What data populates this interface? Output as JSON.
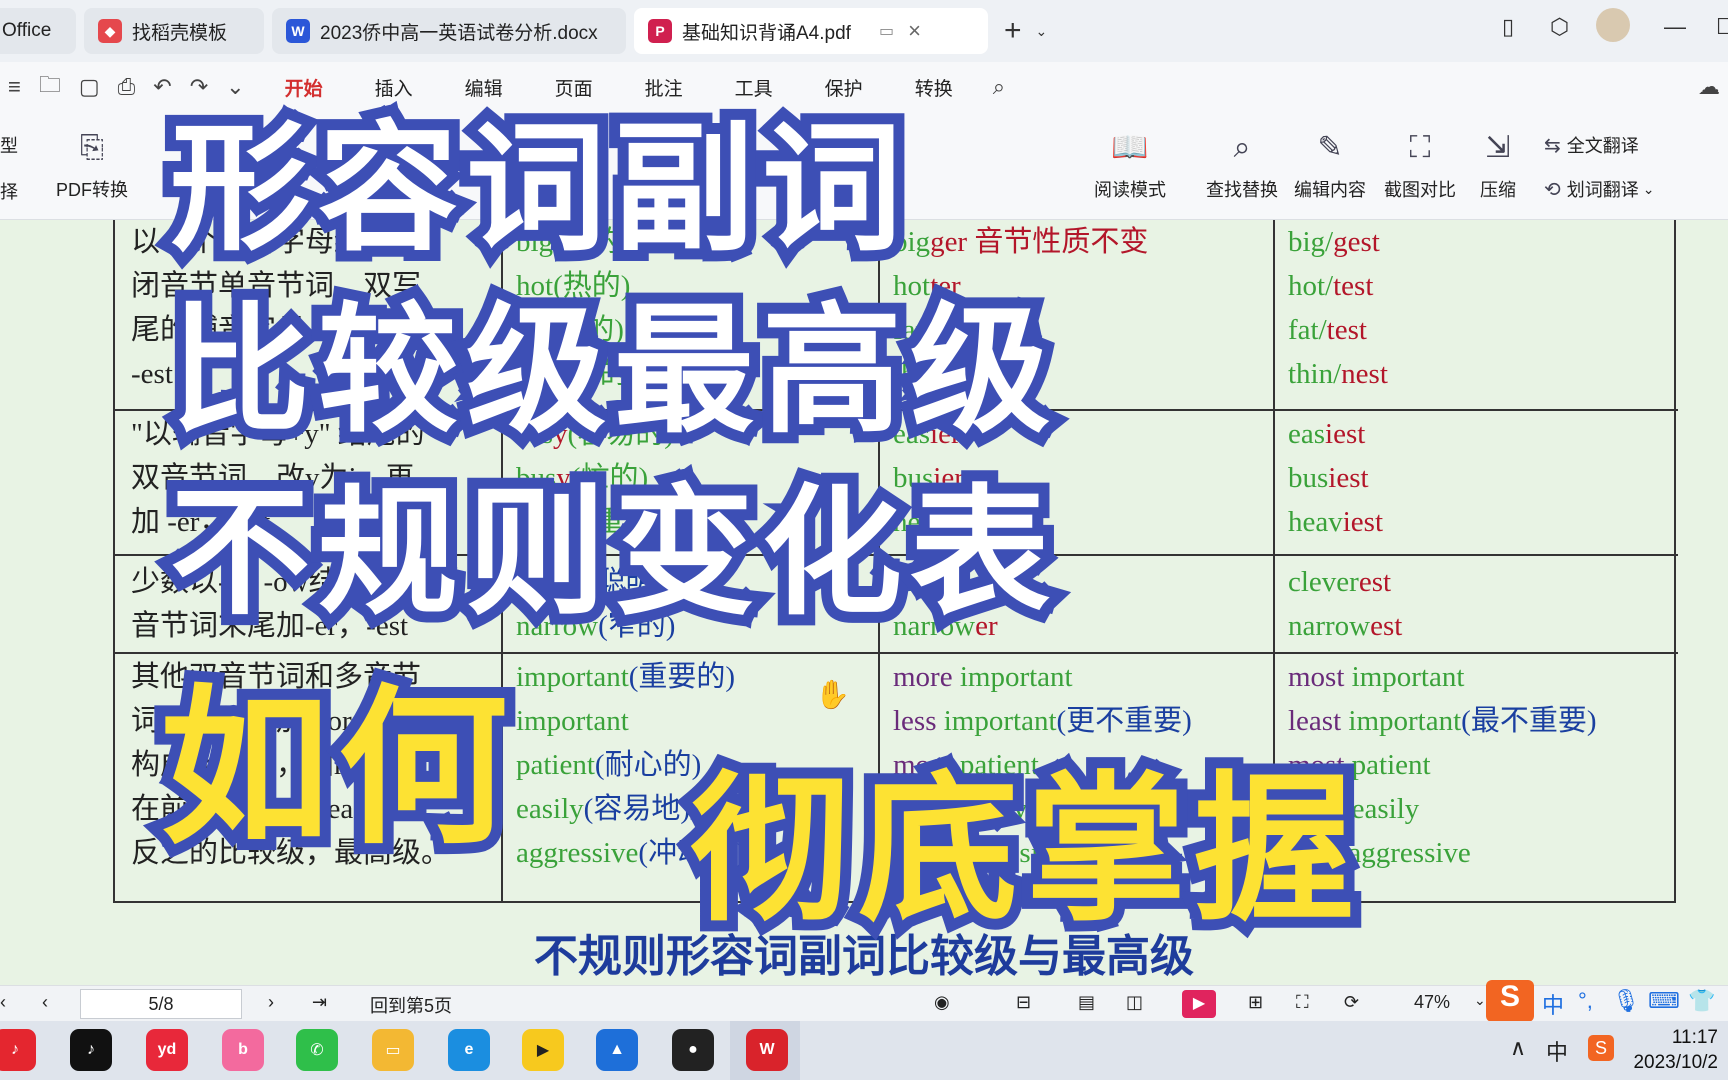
{
  "tabs": [
    {
      "label": "Office",
      "icon": "office-icon",
      "color": "#d32f2f"
    },
    {
      "label": "找稻壳模板",
      "icon": "docer-icon",
      "color": "#e5484d"
    },
    {
      "label": "2023侨中高一英语试卷分析.docx",
      "icon": "word-icon",
      "color": "#2b57d8"
    },
    {
      "label": "基础知识背诵A4.pdf",
      "icon": "pdf-icon",
      "color": "#d0204f"
    }
  ],
  "menu": [
    "开始",
    "插入",
    "编辑",
    "页面",
    "批注",
    "工具",
    "保护",
    "转换"
  ],
  "ribbon": {
    "left_partial_1": "型",
    "left_partial_2": "择",
    "pdf_convert": "PDF转换",
    "read_mode": "阅读模式",
    "find_replace": "查找替换",
    "edit_content": "编辑内容",
    "screenshot_compare": "截图对比",
    "compress": "压缩",
    "full_translate": "全文翻译",
    "word_translate": "划词翻译"
  },
  "table": {
    "rows": [
      {
        "rule": [
          "以一个辅音字母结尾的",
          "闭音节单音节词，双写",
          "尾的辅音字母，再加-er，",
          "-est"
        ],
        "base": [
          [
            "big",
            "(大的)"
          ],
          [
            "hot",
            "(热的)"
          ],
          [
            "fat",
            "(胖的)"
          ],
          [
            "thin",
            "(瘦的)"
          ]
        ],
        "comp": [
          [
            "big",
            "ger",
            " 音节性质不变"
          ],
          [
            "hot",
            "ter",
            ""
          ],
          [
            "fat",
            "ter",
            ""
          ],
          [
            "thin",
            "ner",
            ""
          ]
        ],
        "sup": [
          [
            "big/",
            "gest"
          ],
          [
            "hot/",
            "test"
          ],
          [
            "fat/",
            "test"
          ],
          [
            "thin/",
            "nest"
          ]
        ]
      },
      {
        "rule": [
          "\"以辅音字母+y\" 结尾的",
          "双音节词，改y为i，再",
          "加 -er，-est"
        ],
        "base": [
          [
            "eas",
            "y",
            "(容易的)"
          ],
          [
            "bus",
            "y",
            "(忙的)"
          ],
          [
            "heav",
            "y",
            "(重的)"
          ]
        ],
        "comp": [
          [
            "eas",
            "ier"
          ],
          [
            "bus",
            "ier"
          ],
          [
            "heav",
            "ier"
          ]
        ],
        "sup": [
          [
            "eas",
            "iest"
          ],
          [
            "bus",
            "iest"
          ],
          [
            "heav",
            "iest"
          ]
        ]
      },
      {
        "rule": [
          "少数以-er, -ow结尾的双",
          "音节词末尾加-er，-est"
        ],
        "base": [
          [
            "clever",
            "(聪明的)"
          ],
          [
            "narrow",
            "(窄的)"
          ]
        ],
        "comp": [
          [
            "clev",
            "er"
          ],
          [
            "narrow",
            "er"
          ]
        ],
        "sup": [
          [
            "clever",
            "est"
          ],
          [
            "narrow",
            "est"
          ]
        ]
      },
      {
        "rule": [
          "其他双音节词和多音节",
          "词，在前面加more，",
          "构成比较级，加most",
          "在前面加less，least",
          "反之的比较级，最高级。"
        ],
        "base": [
          [
            "important",
            "(重要的)"
          ],
          [
            "important",
            ""
          ],
          [
            "patient",
            "(耐心的)"
          ],
          [
            "easily",
            "(容易地)"
          ],
          [
            "aggressive",
            "(冲动的)"
          ]
        ],
        "comp": [
          [
            "more",
            " important",
            ""
          ],
          [
            "less",
            " important",
            "(更不重要)"
          ],
          [
            "more",
            " patient",
            ""
          ],
          [
            "more",
            " easily",
            ""
          ],
          [
            "less",
            " aggressive",
            "(不冲动)"
          ]
        ],
        "sup": [
          [
            "most",
            " important",
            ""
          ],
          [
            "least",
            " important",
            "(最不重要)"
          ],
          [
            "most",
            " patient",
            ""
          ],
          [
            "most",
            " easily",
            ""
          ],
          [
            "least",
            " aggressive",
            ""
          ]
        ]
      }
    ]
  },
  "caption": "不规则形容词副词比较级与最高级",
  "overlay": {
    "line1": "形容词副词",
    "line2": "比较级最高级",
    "line3": "不规则变化表",
    "line4": "如何",
    "line5": "彻底掌握"
  },
  "status": {
    "page": "5/8",
    "back_to": "回到第5页",
    "zoom": "47%"
  },
  "clock": {
    "time": "11:17",
    "date": "2023/10/2"
  },
  "tray_ime": "中",
  "taskbar_apps": [
    "netease-music",
    "tiktok",
    "youdao",
    "bilibili",
    "wechat",
    "file-explorer",
    "edge",
    "player",
    "photos",
    "qq",
    "wps"
  ]
}
